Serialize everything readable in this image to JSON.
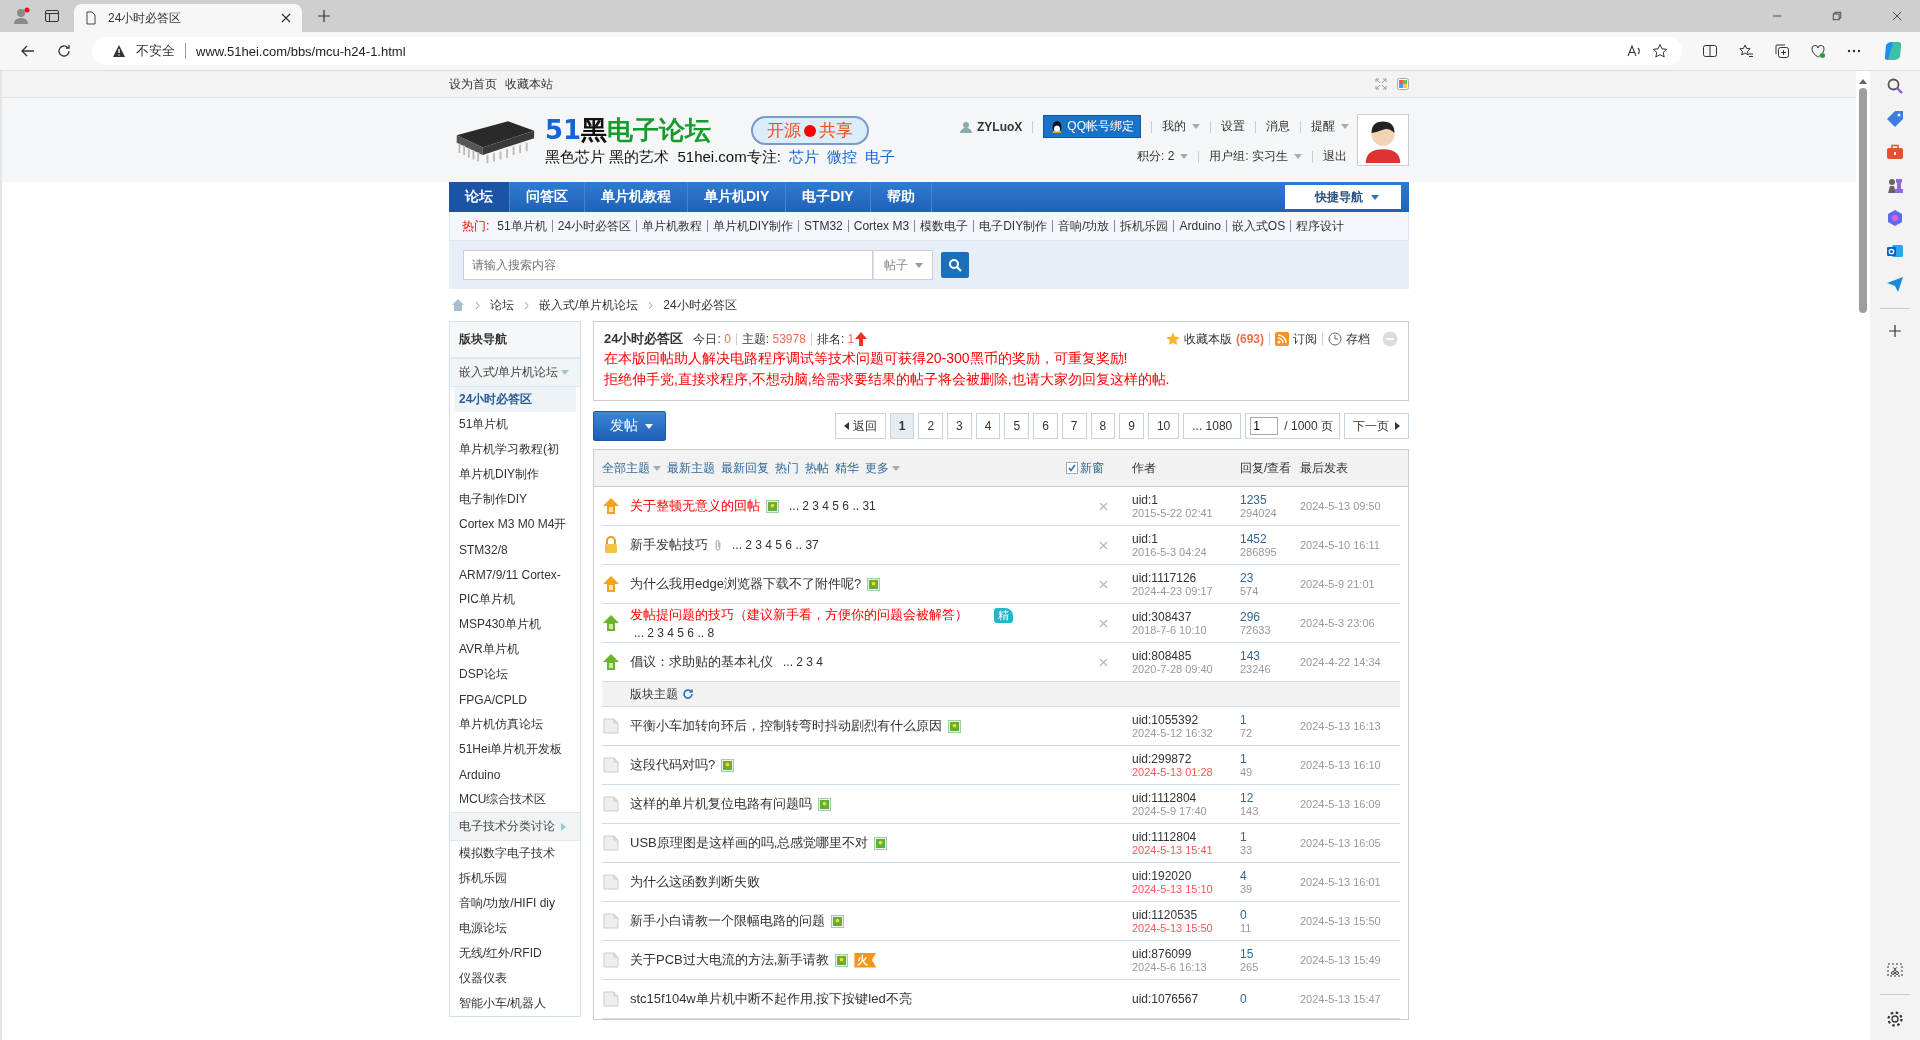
{
  "browser": {
    "tab_title": "24小时必答区",
    "security": "不安全",
    "url": "www.51hei.com/bbs/mcu-h24-1.html"
  },
  "topbar": {
    "links": [
      "设为首页",
      "收藏本站"
    ]
  },
  "header": {
    "logo_number": "51",
    "logo_black": "黑",
    "logo_green": "电子论坛",
    "badge_left": "开源",
    "badge_right": "共享",
    "slogan": "黑色芯片 黑的艺术  51hei.com专注:",
    "slogan_links": [
      "芯片",
      "微控",
      "电子"
    ]
  },
  "user": {
    "name": "ZYLuoX",
    "qq_button": "QQ帐号绑定",
    "menu": [
      {
        "label": "我的",
        "dropdown": true
      },
      {
        "label": "设置",
        "dropdown": false
      },
      {
        "label": "消息",
        "dropdown": false
      },
      {
        "label": "提醒",
        "dropdown": true
      }
    ],
    "info": [
      {
        "label": "积分: 2",
        "dropdown": true
      },
      {
        "label": "用户组: 实习生",
        "dropdown": true
      },
      {
        "label": "退出",
        "dropdown": false
      }
    ]
  },
  "nav": {
    "items": [
      {
        "label": "论坛",
        "selected": true
      },
      {
        "label": "问答区",
        "selected": false
      },
      {
        "label": "单片机教程",
        "selected": false
      },
      {
        "label": "单片机DIY",
        "selected": false
      },
      {
        "label": "电子DIY",
        "selected": false
      },
      {
        "label": "帮助",
        "selected": false
      }
    ],
    "quick_nav": "快捷导航"
  },
  "hot": {
    "label": "热门:",
    "links": [
      "51单片机",
      "24小时必答区",
      "单片机教程",
      "单片机DIY制作",
      "STM32",
      "Cortex M3",
      "模数电子",
      "电子DIY制作",
      "音响/功放",
      "拆机乐园",
      "Arduino",
      "嵌入式OS",
      "程序设计"
    ]
  },
  "search": {
    "placeholder": "请输入搜索内容",
    "type": "帖子"
  },
  "breadcrumb": [
    "论坛",
    "嵌入式/单片机论坛",
    "24小时必答区"
  ],
  "sidebar": {
    "title": "版块导航",
    "groups": [
      {
        "label": "嵌入式/单片机论坛",
        "expanded": true,
        "children": [
          {
            "label": "24小时必答区",
            "selected": true
          },
          {
            "label": "51单片机",
            "selected": false
          },
          {
            "label": "单片机学习教程(初",
            "selected": false
          },
          {
            "label": "单片机DIY制作",
            "selected": false
          },
          {
            "label": "电子制作DIY",
            "selected": false
          },
          {
            "label": "Cortex M3 M0 M4开",
            "selected": false
          },
          {
            "label": "STM32/8",
            "selected": false
          },
          {
            "label": "ARM7/9/11 Cortex-",
            "selected": false
          },
          {
            "label": "PIC单片机",
            "selected": false
          },
          {
            "label": "MSP430单片机",
            "selected": false
          },
          {
            "label": "AVR单片机",
            "selected": false
          },
          {
            "label": "DSP论坛",
            "selected": false
          },
          {
            "label": "FPGA/CPLD",
            "selected": false
          },
          {
            "label": "单片机仿真论坛",
            "selected": false
          },
          {
            "label": "51Hei单片机开发板",
            "selected": false
          },
          {
            "label": "Arduino",
            "selected": false
          },
          {
            "label": "MCU综合技术区",
            "selected": false
          }
        ]
      },
      {
        "label": "电子技术分类讨论",
        "expanded": false,
        "children": [
          {
            "label": "模拟数字电子技术",
            "selected": false
          },
          {
            "label": "拆机乐园",
            "selected": false
          },
          {
            "label": "音响/功放/HIFI diy",
            "selected": false
          },
          {
            "label": "电源论坛",
            "selected": false
          },
          {
            "label": "无线/红外/RFID",
            "selected": false
          },
          {
            "label": "仪器仪表",
            "selected": false
          },
          {
            "label": "智能小车/机器人",
            "selected": false
          }
        ]
      }
    ]
  },
  "forum": {
    "title": "24小时必答区",
    "stats": [
      {
        "label": "今日:",
        "value": "0"
      },
      {
        "label": "主题:",
        "value": "53978"
      },
      {
        "label": "排名:",
        "value": "1"
      }
    ],
    "favorite": "收藏本版",
    "favorite_count": "(693)",
    "subscribe": "订阅",
    "archive": "存档",
    "notice": [
      "在本版回帖助人解决电路程序调试等技术问题可获得20-300黑币的奖励，可重复奖励!",
      "拒绝伸手党,直接求程序,不想动脑,给需求要结果的帖子将会被删除,也请大家勿回复这样的帖."
    ]
  },
  "post_button": "发帖",
  "pager": {
    "back": "返回",
    "pages": [
      {
        "label": "1",
        "selected": true
      },
      {
        "label": "2",
        "selected": false
      },
      {
        "label": "3",
        "selected": false
      },
      {
        "label": "4",
        "selected": false
      },
      {
        "label": "5",
        "selected": false
      },
      {
        "label": "6",
        "selected": false
      },
      {
        "label": "7",
        "selected": false
      },
      {
        "label": "8",
        "selected": false
      },
      {
        "label": "9",
        "selected": false
      },
      {
        "label": "10",
        "selected": false
      },
      {
        "label": "... 1080",
        "selected": false
      }
    ],
    "input": "1",
    "total": "/ 1000 页",
    "next": "下一页"
  },
  "table": {
    "filters": [
      {
        "label": "全部主题",
        "dropdown": true
      },
      {
        "label": "最新主题",
        "dropdown": false
      },
      {
        "label": "最新回复",
        "dropdown": false
      },
      {
        "label": "热门",
        "dropdown": false
      },
      {
        "label": "热帖",
        "dropdown": false
      },
      {
        "label": "精华",
        "dropdown": false
      },
      {
        "label": "更多",
        "dropdown": true
      }
    ],
    "new_window": {
      "label": "新窗",
      "checked": true
    },
    "columns": [
      "作者",
      "回复/查看",
      "最后发表"
    ],
    "sticky": [
      {
        "kind": "pin3",
        "title": "关于整顿无意义的回帖",
        "highlight": true,
        "image": true,
        "attachment": false,
        "pages": "... 2 3 4 5 6 .. 31",
        "author": "uid:1",
        "date": "2015-5-22 02:41",
        "date_new": false,
        "replies": "1235",
        "views": "294024",
        "last": "2024-5-13 09:50"
      },
      {
        "kind": "lock",
        "title": "新手发帖技巧",
        "highlight": false,
        "image": false,
        "attachment": true,
        "pages": "... 2 3 4 5 6 .. 37",
        "author": "uid:1",
        "date": "2016-5-3 04:24",
        "date_new": false,
        "replies": "1452",
        "views": "286895",
        "last": "2024-5-10 16:11"
      },
      {
        "kind": "pin3",
        "title": "为什么我用edge浏览器下载不了附件呢?",
        "highlight": false,
        "image": true,
        "attachment": false,
        "author": "uid:1117126",
        "date": "2024-4-23 09:17",
        "date_new": false,
        "replies": "23",
        "views": "574",
        "last": "2024-5-9 21:01"
      },
      {
        "kind": "pin1",
        "title": "发帖提问题的技巧（建议新手看，方便你的问题会被解答）",
        "highlight": true,
        "image": false,
        "attachment": false,
        "badge": "精",
        "pages": "... 2 3 4 5 6 .. 8",
        "author": "uid:308437",
        "date": "2018-7-6 10:10",
        "date_new": false,
        "replies": "296",
        "views": "72633",
        "last": "2024-5-3 23:06"
      },
      {
        "kind": "pin1",
        "title": "倡议：求助贴的基本礼仪",
        "highlight": false,
        "image": false,
        "attachment": false,
        "pages": "... 2 3 4",
        "author": "uid:808485",
        "date": "2020-7-28 09:40",
        "date_new": false,
        "replies": "143",
        "views": "23246",
        "last": "2024-4-22 14:34"
      }
    ],
    "separator": "版块主题",
    "threads": [
      {
        "title": "平衡小车加转向环后，控制转弯时抖动剧烈有什么原因",
        "image": true,
        "author": "uid:1055392",
        "date": "2024-5-12 16:32",
        "date_new": false,
        "replies": "1",
        "views": "72",
        "last": "2024-5-13 16:13"
      },
      {
        "title": "这段代码对吗?",
        "image": true,
        "author": "uid:299872",
        "date": "2024-5-13 01:28",
        "date_new": true,
        "replies": "1",
        "views": "49",
        "last": "2024-5-13 16:10"
      },
      {
        "title": "这样的单片机复位电路有问题吗",
        "image": true,
        "author": "uid:1112804",
        "date": "2024-5-9 17:40",
        "date_new": false,
        "replies": "12",
        "views": "143",
        "last": "2024-5-13 16:09"
      },
      {
        "title": "USB原理图是这样画的吗,总感觉哪里不对",
        "image": true,
        "author": "uid:1112804",
        "date": "2024-5-13 15:41",
        "date_new": true,
        "replies": "1",
        "views": "33",
        "last": "2024-5-13 16:05"
      },
      {
        "title": "为什么这函数判断失败",
        "image": false,
        "author": "uid:192020",
        "date": "2024-5-13 15:10",
        "date_new": true,
        "replies": "4",
        "views": "39",
        "last": "2024-5-13 16:01"
      },
      {
        "title": "新手小白请教一个限幅电路的问题",
        "image": true,
        "author": "uid:1120535",
        "date": "2024-5-13 15:50",
        "date_new": true,
        "replies": "0",
        "views": "11",
        "last": "2024-5-13 15:50"
      },
      {
        "title": "关于PCB过大电流的方法,新手请教",
        "image": true,
        "hot": "火",
        "author": "uid:876099",
        "date": "2024-5-6 16:13",
        "date_new": false,
        "replies": "15",
        "views": "265",
        "last": "2024-5-13 15:49"
      },
      {
        "title": "stc15f104w单片机中断不起作用,按下按键led不亮",
        "image": false,
        "author": "uid:1076567",
        "replies": "0",
        "last": "2024-5-13 15:47"
      }
    ]
  }
}
